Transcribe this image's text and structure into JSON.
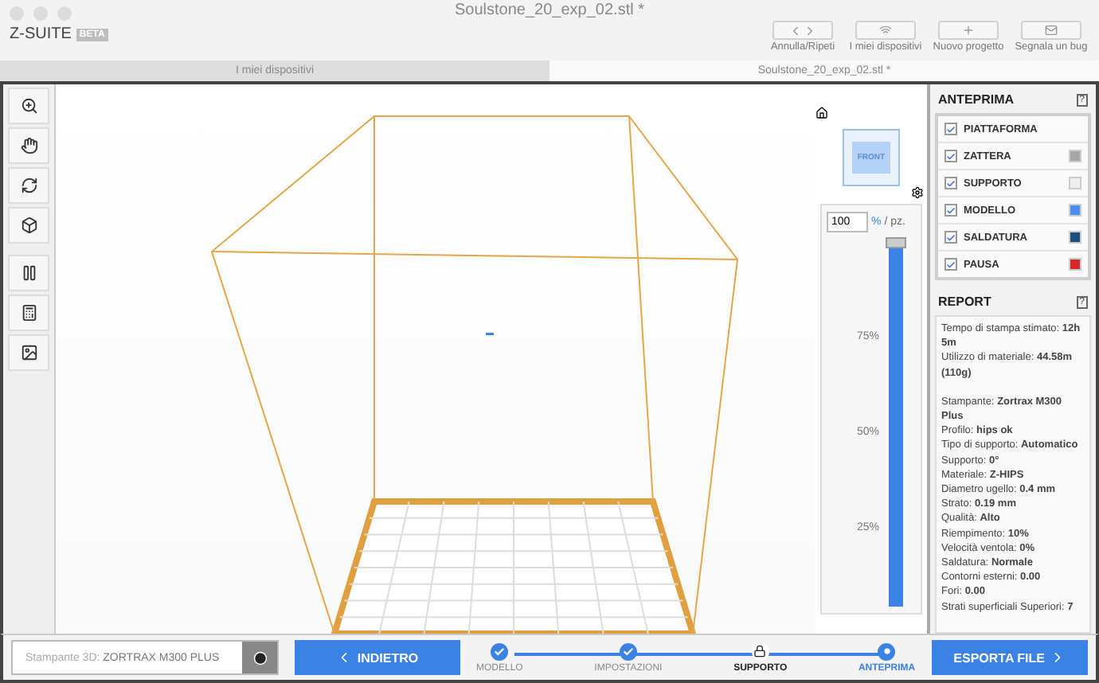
{
  "window": {
    "title": "Soulstone_20_exp_02.stl *"
  },
  "app": {
    "logo": "Z-SUITE",
    "badge": "BETA"
  },
  "toolbar": [
    {
      "kind": "undo",
      "label": "Annulla/Ripeti"
    },
    {
      "kind": "wifi",
      "label": "I miei dispositivi"
    },
    {
      "kind": "plus",
      "label": "Nuovo progetto"
    },
    {
      "kind": "mail",
      "label": "Segnala un bug"
    }
  ],
  "tabs": [
    {
      "label": "I miei dispositivi",
      "selected": false
    },
    {
      "label": "Soulstone_20_exp_02.stl *",
      "selected": true
    }
  ],
  "tools": [
    {
      "kind": "zoom"
    },
    {
      "kind": "hand"
    },
    {
      "kind": "rotate"
    },
    {
      "kind": "cube"
    },
    {
      "kind": "pause"
    },
    {
      "kind": "math"
    },
    {
      "kind": "image"
    }
  ],
  "viewcube": {
    "face": "FRONT"
  },
  "layers": {
    "value": "100",
    "unit": "%",
    "per": "/ pz.",
    "level": 1,
    "ticks": [
      "75%",
      "50%",
      "25%"
    ]
  },
  "preview": {
    "title": "ANTEPRIMA",
    "help": "?",
    "items": [
      {
        "label": "PIATTAFORMA",
        "checked": true
      },
      {
        "label": "ZATTERA",
        "checked": true,
        "color": "#a6a6a6"
      },
      {
        "label": "SUPPORTO",
        "checked": true,
        "color": "#eeeeee"
      },
      {
        "label": "MODELLO",
        "checked": true,
        "color": "#4a8ff0"
      },
      {
        "label": "SALDATURA",
        "checked": true,
        "color": "#1f4e7a"
      },
      {
        "label": "PAUSA",
        "checked": true,
        "color": "#d42a2a"
      }
    ]
  },
  "report": {
    "title": "REPORT",
    "help": "?",
    "summary": [
      "Tempo di stampa stimato: **12h 5m**",
      "Utilizzo di materiale: **44.58m (110g)**"
    ],
    "lines": [
      "Stampante: **Zortrax M300 Plus**",
      "Profilo: **hips ok**",
      "Tipo di supporto: **Automatico**",
      "Supporto: **0°**",
      "Materiale: **Z-HIPS**",
      "Diametro ugello: **0.4 mm**",
      "Strato: **0.19 mm**",
      "Qualità: **Alto**",
      "Riempimento: **10%**",
      "Velocità ventola: **0%**",
      "Saldatura: **Normale**",
      "Contorni esterni: **0.00**",
      "Fori: **0.00**",
      "Strati superficiali Superiori: **7**"
    ]
  },
  "printer": {
    "label": "Stampante 3D:",
    "value": "ZORTRAX M300 PLUS"
  },
  "back": "INDIETRO",
  "steps": [
    {
      "label": "MODELLO",
      "kind": "done"
    },
    {
      "label": "IMPOSTAZIONI",
      "kind": "done"
    },
    {
      "label": "SUPPORTO",
      "kind": "locked"
    },
    {
      "label": "ANTEPRIMA",
      "kind": "active"
    }
  ],
  "export": "ESPORTA FILE"
}
